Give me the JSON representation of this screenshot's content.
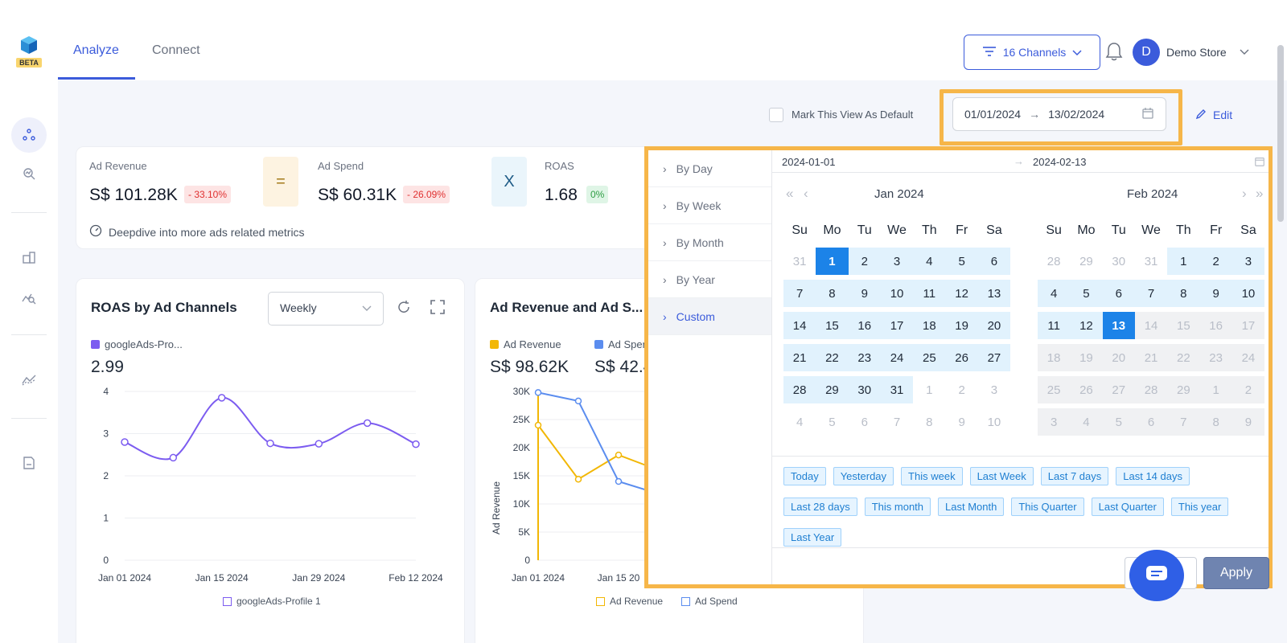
{
  "header": {
    "beta_badge": "BETA",
    "tabs": [
      {
        "label": "Analyze"
      },
      {
        "label": "Connect"
      }
    ],
    "channels_label": "16 Channels",
    "avatar_initial": "D",
    "store_name": "Demo Store"
  },
  "filters": {
    "default_label": "Mark This View As Default",
    "date_start": "01/01/2024",
    "date_arrow": "→",
    "date_end": "13/02/2024",
    "edit_label": "Edit"
  },
  "kpis": {
    "ad_revenue": {
      "label": "Ad Revenue",
      "value": "S$ 101.28K",
      "change": "- 33.10%"
    },
    "equals": "=",
    "ad_spend": {
      "label": "Ad Spend",
      "value": "S$ 60.31K",
      "change": "- 26.09%"
    },
    "times": "X",
    "roas": {
      "label": "ROAS",
      "value": "1.68",
      "change": "0%"
    },
    "deepdive_label": "Deepdive into more ads related metrics"
  },
  "roas_card": {
    "title": "ROAS by Ad Channels",
    "select_value": "Weekly",
    "legend_label": "googleAds-Pro...",
    "big_value": "2.99",
    "bottom_legend": "googleAds-Profile 1"
  },
  "revenue_card": {
    "title": "Ad Revenue and Ad S...",
    "legend_revenue": "Ad Revenue",
    "legend_spend": "Ad Spen",
    "revenue_value": "S$ 98.62K",
    "spend_value": "S$ 42.4",
    "bottom_legend_revenue": "Ad Revenue",
    "bottom_legend_spend": "Ad Spend"
  },
  "chart_data": [
    {
      "type": "line",
      "title": "ROAS by Ad Channels",
      "x": [
        "Jan 01 2024",
        "Jan 08 2024",
        "Jan 15 2024",
        "Jan 22 2024",
        "Jan 29 2024",
        "Feb 05 2024",
        "Feb 12 2024"
      ],
      "x_tick_labels": [
        "Jan 01 2024",
        "Jan 15 2024",
        "Jan 29 2024",
        "Feb 12 2024"
      ],
      "y_ticks": [
        "0",
        "1",
        "2",
        "3",
        "4"
      ],
      "ylim": [
        0,
        4
      ],
      "grid": true,
      "series": [
        {
          "name": "googleAds-Profile 1",
          "values": [
            2.8,
            2.43,
            3.85,
            2.77,
            2.76,
            3.25,
            2.75
          ],
          "color": "#7c5cf0"
        }
      ]
    },
    {
      "type": "line",
      "title": "Ad Revenue and Ad S...",
      "ylabel": "Ad Revenue",
      "x_tick_labels": [
        "Jan 01 2024",
        "Jan 15 20"
      ],
      "y_ticks": [
        "0",
        "5K",
        "10K",
        "15K",
        "20K",
        "25K",
        "30K"
      ],
      "ylim": [
        0,
        30000
      ],
      "grid": true,
      "series": [
        {
          "name": "Ad Revenue",
          "values": [
            24000,
            14400,
            18700,
            16000
          ],
          "color": "#f2b705"
        },
        {
          "name": "Ad Spend",
          "values": [
            29800,
            28300,
            14000,
            11800
          ],
          "color": "#5b8def"
        }
      ]
    }
  ],
  "picker": {
    "ranges": [
      {
        "label": "By Day"
      },
      {
        "label": "By Week"
      },
      {
        "label": "By Month"
      },
      {
        "label": "By Year"
      },
      {
        "label": "Custom"
      }
    ],
    "start_input": "2024-01-01",
    "end_input": "2024-02-13",
    "left_month": "Jan  2024",
    "right_month": "Feb  2024",
    "weekdays": [
      "Su",
      "Mo",
      "Tu",
      "We",
      "Th",
      "Fr",
      "Sa"
    ],
    "jan_days": [
      "31",
      "1",
      "2",
      "3",
      "4",
      "5",
      "6",
      "7",
      "8",
      "9",
      "10",
      "11",
      "12",
      "13",
      "14",
      "15",
      "16",
      "17",
      "18",
      "19",
      "20",
      "21",
      "22",
      "23",
      "24",
      "25",
      "26",
      "27",
      "28",
      "29",
      "30",
      "31",
      "1",
      "2",
      "3",
      "4",
      "5",
      "6",
      "7",
      "8",
      "9",
      "10"
    ],
    "feb_days": [
      "28",
      "29",
      "30",
      "31",
      "1",
      "2",
      "3",
      "4",
      "5",
      "6",
      "7",
      "8",
      "9",
      "10",
      "11",
      "12",
      "13",
      "14",
      "15",
      "16",
      "17",
      "18",
      "19",
      "20",
      "21",
      "22",
      "23",
      "24",
      "25",
      "26",
      "27",
      "28",
      "29",
      "1",
      "2",
      "3",
      "4",
      "5",
      "6",
      "7",
      "8",
      "9"
    ],
    "quick_ranges": [
      "Today",
      "Yesterday",
      "This week",
      "Last Week",
      "Last 7 days",
      "Last 14 days",
      "Last 28 days",
      "This month",
      "Last Month",
      "This Quarter",
      "Last Quarter",
      "This year",
      "Last Year"
    ],
    "apply_label": "Apply"
  }
}
